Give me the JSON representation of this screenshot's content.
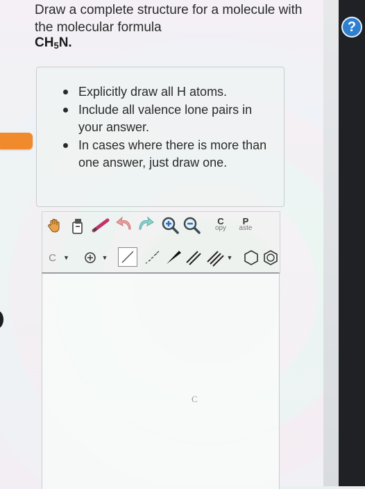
{
  "question": {
    "text": "Draw a complete structure for a molecule with the molecular formula",
    "formula_main": "CH",
    "formula_sub": "5",
    "formula_tail": "N."
  },
  "instructions": [
    "Explicitly draw all H atoms.",
    "Include all valence lone pairs in your answer.",
    "In cases where there is more than one answer, just draw one."
  ],
  "help": {
    "label": "?"
  },
  "toolbar": {
    "copy_letter": "C",
    "copy_rest": "opy",
    "paste_letter": "P",
    "paste_rest": "aste",
    "element_select": "C",
    "colors": {
      "accent": "#f08a2c",
      "help": "#2f7fd0"
    }
  },
  "canvas": {
    "atom_label": "C"
  }
}
